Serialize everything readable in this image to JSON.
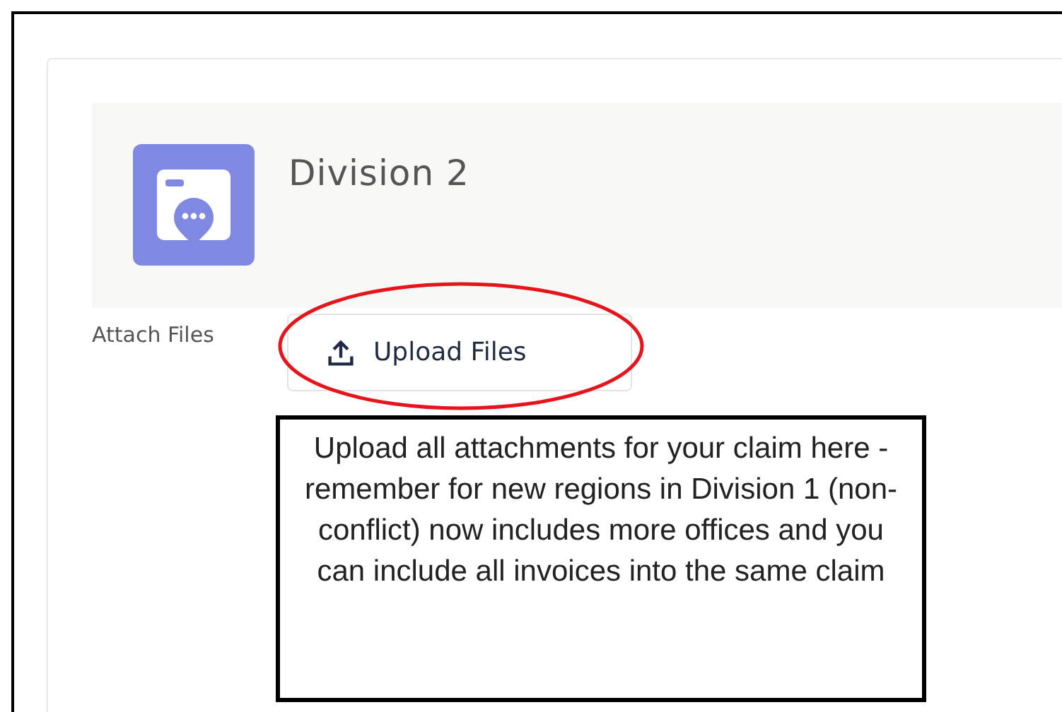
{
  "header": {
    "title": "Division 2"
  },
  "attach": {
    "label": "Attach Files",
    "button": "Upload Files"
  },
  "callout": {
    "text": "Upload all attachments for your claim here - remember for new regions in Division 1 (non-conflict) now includes more offices and you can include all invoices into the same claim"
  }
}
